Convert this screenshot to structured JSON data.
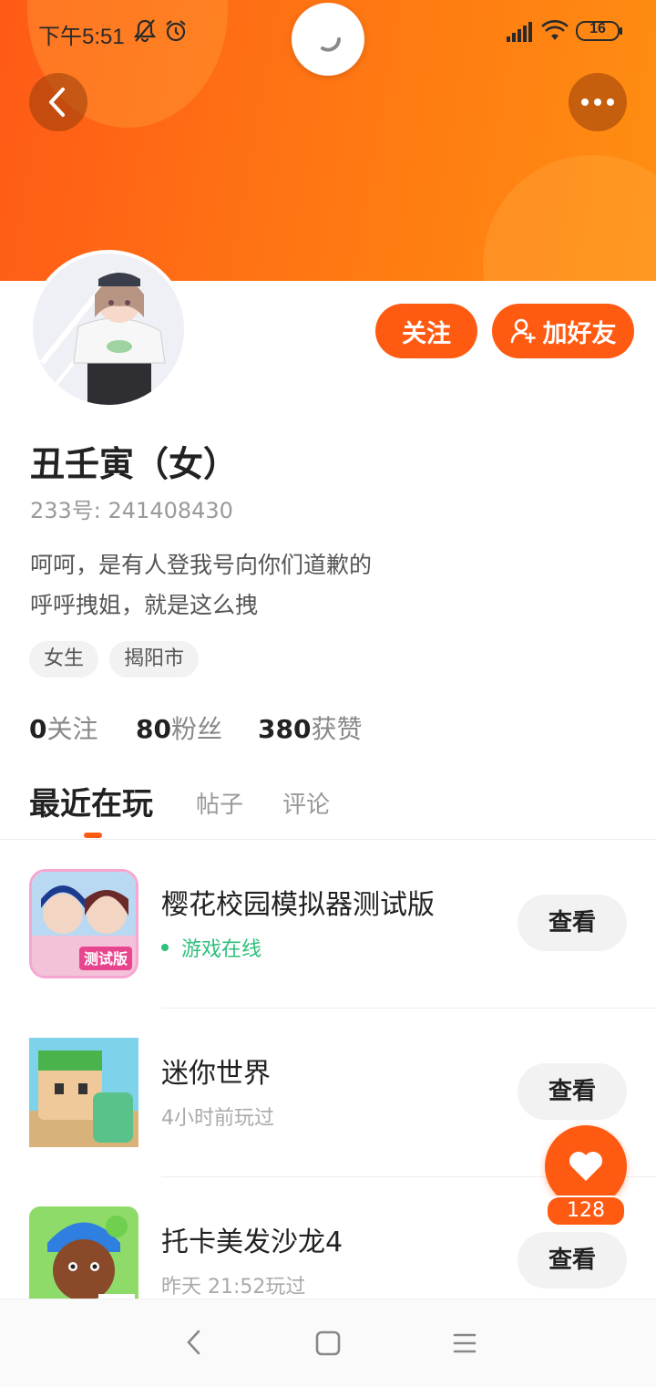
{
  "status_bar": {
    "time": "下午5:51",
    "battery": "16",
    "icons": [
      "mute-bell-icon",
      "alarm-icon",
      "signal-icon",
      "wifi-icon",
      "battery-icon"
    ]
  },
  "header": {
    "back_icon": "chevron-left-icon",
    "more_icon": "ellipsis-icon",
    "loading_icon": "spinner-icon"
  },
  "profile": {
    "name": "丑壬寅（女）",
    "uid": "233号: 241408430",
    "bio_lines": [
      "呵呵，是有人登我号向你们道歉的",
      "呼呼拽姐，就是这么拽"
    ],
    "tags": [
      "女生",
      "揭阳市"
    ],
    "follow_label": "关注",
    "add_friend_label": "加好友",
    "stats": [
      {
        "value": "0",
        "label": "关注"
      },
      {
        "value": "80",
        "label": "粉丝"
      },
      {
        "value": "380",
        "label": "获赞"
      }
    ]
  },
  "tabs": [
    {
      "label": "最近在玩",
      "active": true
    },
    {
      "label": "帖子",
      "active": false
    },
    {
      "label": "评论",
      "active": false
    }
  ],
  "games": [
    {
      "title": "樱花校园模拟器测试版",
      "subtitle": "游戏在线",
      "online": true,
      "badge": "测试版",
      "action": "查看"
    },
    {
      "title": "迷你世界",
      "subtitle": "4小时前玩过",
      "online": false,
      "action": "查看"
    },
    {
      "title": "托卡美发沙龙4",
      "subtitle": "昨天 21:52玩过",
      "online": false,
      "action": "查看"
    }
  ],
  "like_fab": {
    "count": "128",
    "icon": "heart-icon"
  },
  "colors": {
    "accent": "#ff5a12",
    "online": "#2ec07c"
  }
}
